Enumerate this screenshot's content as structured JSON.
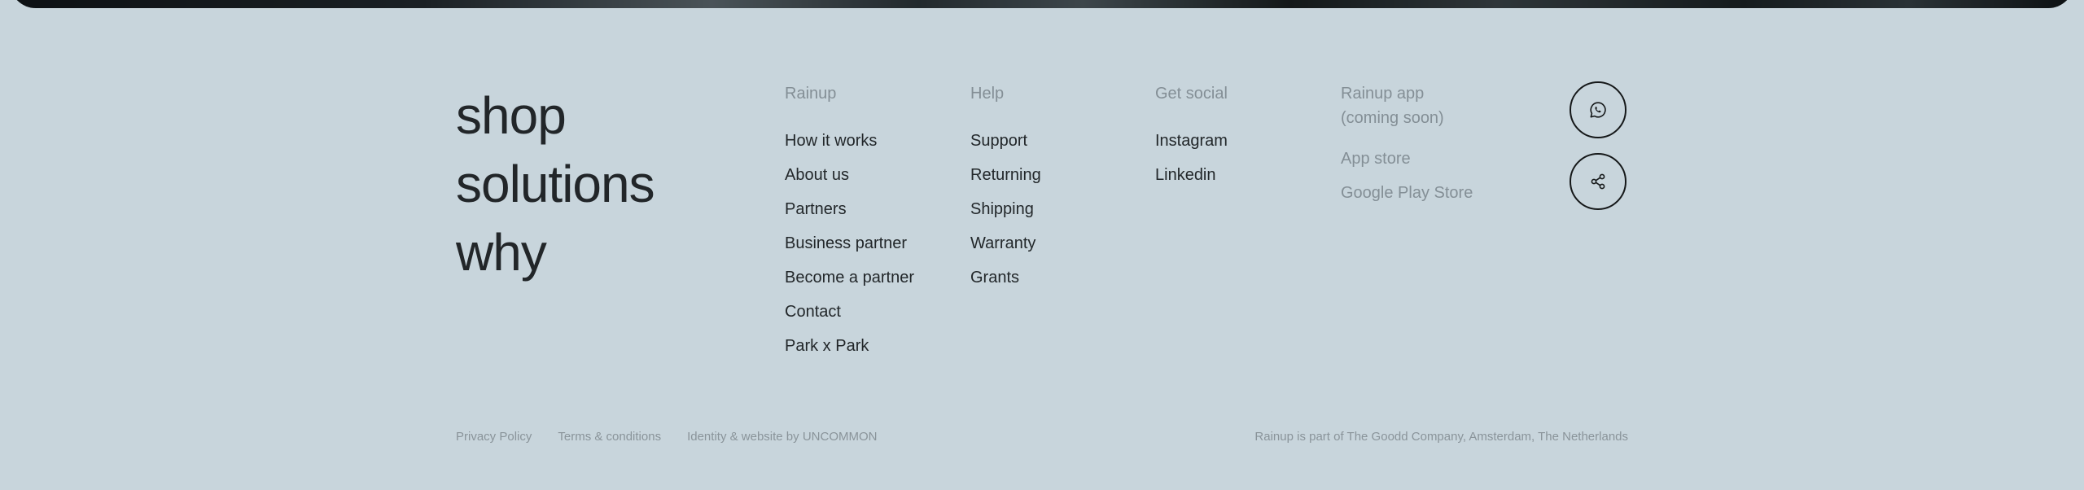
{
  "big_nav": [
    "shop",
    "solutions",
    "why"
  ],
  "columns": {
    "rainup": {
      "heading": "Rainup",
      "links": [
        "How it works",
        "About us",
        "Partners",
        "Business partner",
        "Become a partner",
        "Contact",
        "Park x Park"
      ]
    },
    "help": {
      "heading": "Help",
      "links": [
        "Support",
        "Returning",
        "Shipping",
        "Warranty",
        "Grants"
      ]
    },
    "social": {
      "heading": "Get social",
      "links": [
        "Instagram",
        "Linkedin"
      ]
    },
    "app": {
      "heading": "Rainup app (coming soon)",
      "links": [
        "App store",
        "Google Play Store"
      ]
    }
  },
  "icons": {
    "whatsapp": "whatsapp-icon",
    "share": "share-icon"
  },
  "footer": {
    "privacy": "Privacy Policy",
    "terms": "Terms & conditions",
    "credit": "Identity & website by UNCOMMON",
    "company": "Rainup is part of The Goodd Company, Amsterdam, The Netherlands"
  },
  "colors": {
    "background": "#c8d5dc",
    "text": "#1f2326",
    "muted": "#848f96"
  }
}
